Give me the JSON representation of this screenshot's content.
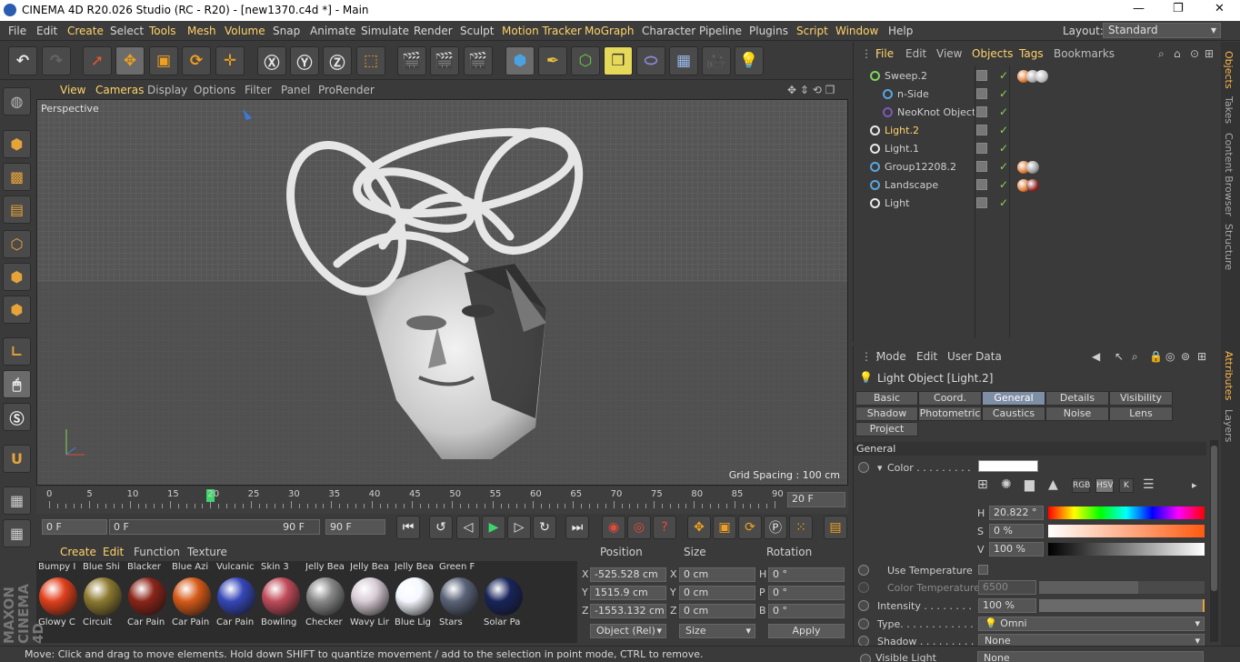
{
  "window": {
    "title": "CINEMA 4D R20.026 Studio (RC - R20) - [new1370.c4d *] - Main",
    "controls": [
      "—",
      "❐",
      "✕"
    ]
  },
  "menu": {
    "items": [
      "File",
      "Edit",
      "Create",
      "Select",
      "Tools",
      "Mesh",
      "Volume",
      "Snap",
      "Animate",
      "Simulate",
      "Render",
      "Sculpt",
      "Motion Tracker",
      "MoGraph",
      "Character",
      "Pipeline",
      "Plugins",
      "Script",
      "Window",
      "Help"
    ],
    "layout_label": "Layout:",
    "layout_value": "Standard"
  },
  "viewport": {
    "menu": [
      "View",
      "Cameras",
      "Display",
      "Options",
      "Filter",
      "Panel",
      "ProRender"
    ],
    "label": "Perspective",
    "grid_spacing": "Grid Spacing : 100 cm"
  },
  "timeline": {
    "ticks": [
      "0",
      "5",
      "10",
      "15",
      "20",
      "25",
      "30",
      "35",
      "40",
      "45",
      "50",
      "55",
      "60",
      "65",
      "70",
      "75",
      "80",
      "85",
      "90"
    ],
    "current_frame": "20 F",
    "playhead_frame": 20
  },
  "transport": {
    "start": "0 F",
    "range_start": "0 F",
    "range_end": "90 F",
    "end": "90 F"
  },
  "materials": {
    "tabs": [
      "Create",
      "Edit",
      "Function",
      "Texture"
    ],
    "top_names": [
      "Bumpy I",
      "Blue Shi",
      "Blacker",
      "Blue Azi",
      "Vulcanic",
      "Skin 3",
      "Jelly Bea",
      "Jelly Bea",
      "Jelly Bea",
      "Green F"
    ],
    "items": [
      {
        "name": "Glowy C",
        "color": "#e0401c"
      },
      {
        "name": "Circuit",
        "color": "#8c7a30"
      },
      {
        "name": "Car Pain",
        "color": "#8a2418"
      },
      {
        "name": "Car Pain",
        "color": "#d65a18"
      },
      {
        "name": "Car Pain",
        "color": "#3547b8"
      },
      {
        "name": "Bowling",
        "color": "#c04b5a"
      },
      {
        "name": "Checker",
        "color": "#888888"
      },
      {
        "name": "Wavy Lir",
        "color": "#d8ccd4"
      },
      {
        "name": "Blue Lig",
        "color": "#f4f8ff"
      },
      {
        "name": "Stars",
        "color": "#5a6378"
      },
      {
        "name": "Solar Pa",
        "color": "#18245a"
      }
    ]
  },
  "coords": {
    "headers": [
      "Position",
      "Size",
      "Rotation"
    ],
    "rows": [
      {
        "axis": "X",
        "pos": "-525.528 cm",
        "size": "0 cm",
        "rot_axis": "H",
        "rot": "0 °"
      },
      {
        "axis": "Y",
        "pos": "1515.9 cm",
        "size": "0 cm",
        "rot_axis": "P",
        "rot": "0 °"
      },
      {
        "axis": "Z",
        "pos": "-1553.132 cm",
        "size": "0 cm",
        "rot_axis": "B",
        "rot": "0 °"
      }
    ],
    "mode": "Object (Rel)",
    "size_mode": "Size",
    "apply": "Apply"
  },
  "objects": {
    "menu": [
      "File",
      "Edit",
      "View",
      "Objects",
      "Tags",
      "Bookmarks"
    ],
    "rows": [
      {
        "name": "Sweep.2",
        "indent": 0,
        "icon": "#7fd45b",
        "selected": false,
        "tags": [
          "#e07a2e",
          "#a8a8a8",
          "#bbbbbb"
        ]
      },
      {
        "name": "n-Side",
        "indent": 1,
        "icon": "#5aa5e0",
        "selected": false,
        "tags": []
      },
      {
        "name": "NeoKnot Object",
        "indent": 1,
        "icon": "#7a5ab8",
        "selected": false,
        "tags": []
      },
      {
        "name": "Light.2",
        "indent": 0,
        "icon": "#e8e8e8",
        "selected": true,
        "tags": []
      },
      {
        "name": "Light.1",
        "indent": 0,
        "icon": "#e8e8e8",
        "selected": false,
        "tags": []
      },
      {
        "name": "Group12208.2",
        "indent": 0,
        "icon": "#5aa5e0",
        "selected": false,
        "tags": [
          "#e07a2e",
          "#999999"
        ]
      },
      {
        "name": "Landscape",
        "indent": 0,
        "icon": "#5aa5e0",
        "selected": false,
        "tags": [
          "#e07a2e",
          "#8c2222"
        ]
      },
      {
        "name": "Light",
        "indent": 0,
        "icon": "#e8e8e8",
        "selected": false,
        "tags": []
      }
    ]
  },
  "side_tabs_top": [
    "Objects",
    "Takes",
    "Content Browser",
    "Structure"
  ],
  "side_tabs_bottom": [
    "Attributes",
    "Layers"
  ],
  "attributes": {
    "menu": [
      "Mode",
      "Edit",
      "User Data"
    ],
    "object_title": "Light Object [Light.2]",
    "tabs_row1": [
      "Basic",
      "Coord.",
      "General",
      "Details",
      "Visibility"
    ],
    "tabs_row2": [
      "Shadow",
      "Photometric",
      "Caustics",
      "Noise",
      "Lens"
    ],
    "tabs_row3": [
      "Project"
    ],
    "active_tab": "General",
    "section": "General",
    "color_label": "Color . . . . . . . . .",
    "color_modes": [
      "RGB",
      "HSV",
      "K"
    ],
    "h_label": "H",
    "h_value": "20.822 °",
    "s_label": "S",
    "s_value": "0 %",
    "v_label": "V",
    "v_value": "100 %",
    "use_temp": "Use Temperature",
    "color_temp_label": "Color Temperature",
    "color_temp_value": "6500",
    "intensity_label": "Intensity . . . . . . . .",
    "intensity_value": "100 %",
    "intensity_fraction": 1.0,
    "type_label": "Type. . . . . . . . . . . .",
    "type_value": "Omni",
    "shadow_label": "Shadow . . . . . . . . .",
    "shadow_value": "None",
    "visible_light_label": "Visible Light",
    "visible_light_value": "None"
  },
  "status": "Move: Click and drag to move elements. Hold down SHIFT to quantize movement / add to the selection in point mode, CTRL to remove."
}
